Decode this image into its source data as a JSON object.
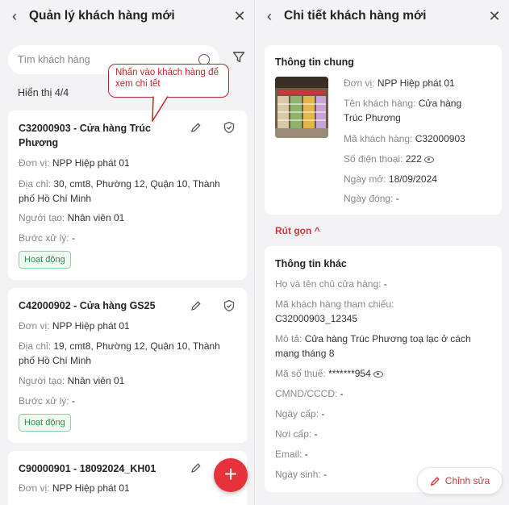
{
  "left": {
    "header": {
      "back_icon": "chevron-left-icon",
      "title": "Quản lý khách hàng mới",
      "close_icon": "close-icon"
    },
    "search": {
      "placeholder": "Tìm khách hàng",
      "search_icon": "search-icon",
      "filter_icon": "filter-icon"
    },
    "count_text": "Hiển thị 4/4",
    "callout": "Nhấn vào khách hàng để xem chi tết",
    "labels": {
      "unit": "Đơn vị:",
      "address": "Địa chỉ:",
      "creator": "Người tạo:",
      "step": "Bước xử lý:"
    },
    "customers": [
      {
        "name": "C32000903 - Cửa hàng Trúc Phương",
        "unit": "NPP Hiệp phát 01",
        "address": "30, cmt8, Phường 12, Quận 10, Thành phố Hồ Chí Minh",
        "creator": "Nhân viên 01",
        "step": "-",
        "status": "Hoạt động"
      },
      {
        "name": "C42000902 - Cửa hàng GS25",
        "unit": "NPP Hiệp phát 01",
        "address": "19, cmt8, Phường 12, Quận 10, Thành phố Hồ Chí Minh",
        "creator": "Nhân viên 01",
        "step": "-",
        "status": "Hoạt động"
      },
      {
        "name": "C90000901 - 18092024_KH01",
        "unit": "NPP Hiệp phát 01"
      }
    ],
    "fab_label": "+"
  },
  "right": {
    "header": {
      "back_icon": "chevron-left-icon",
      "title": "Chi tiết khách hàng mới",
      "close_icon": "close-icon"
    },
    "general": {
      "title": "Thông tin chung",
      "rows": [
        {
          "k": "Đơn vị:",
          "v": "NPP Hiệp phát 01"
        },
        {
          "k": "Tên khách hàng:",
          "v": "Cửa hàng Trúc Phương"
        },
        {
          "k": "Mã khách hàng:",
          "v": "C32000903"
        },
        {
          "k": "Số điện thoại:",
          "v": "222"
        },
        {
          "k": "Ngày mở:",
          "v": "18/09/2024"
        },
        {
          "k": "Ngày đóng:",
          "v": "-"
        }
      ]
    },
    "collapse_label": "Rút gọn ^",
    "other": {
      "title": "Thông tin khác",
      "rows": [
        {
          "k": "Họ và tên chủ cửa hàng:",
          "v": "-"
        },
        {
          "k": "Mã khách hàng tham chiếu:",
          "v": "C32000903_12345"
        },
        {
          "k": "Mô tả:",
          "v": "Cửa hàng Trúc Phương toạ lạc ở cách mạng tháng 8"
        },
        {
          "k": "Mã số thuế:",
          "v": "*******954"
        },
        {
          "k": "CMND/CCCD:",
          "v": "-"
        },
        {
          "k": "Ngày cấp:",
          "v": "-"
        },
        {
          "k": "Nơi cấp:",
          "v": "-"
        },
        {
          "k": "Email:",
          "v": "-"
        },
        {
          "k": "Ngày sinh:",
          "v": "-"
        }
      ]
    },
    "edit_label": "Chỉnh sửa",
    "colors": {
      "accent": "#e8323b",
      "active_green": "#2a8f4a"
    }
  }
}
